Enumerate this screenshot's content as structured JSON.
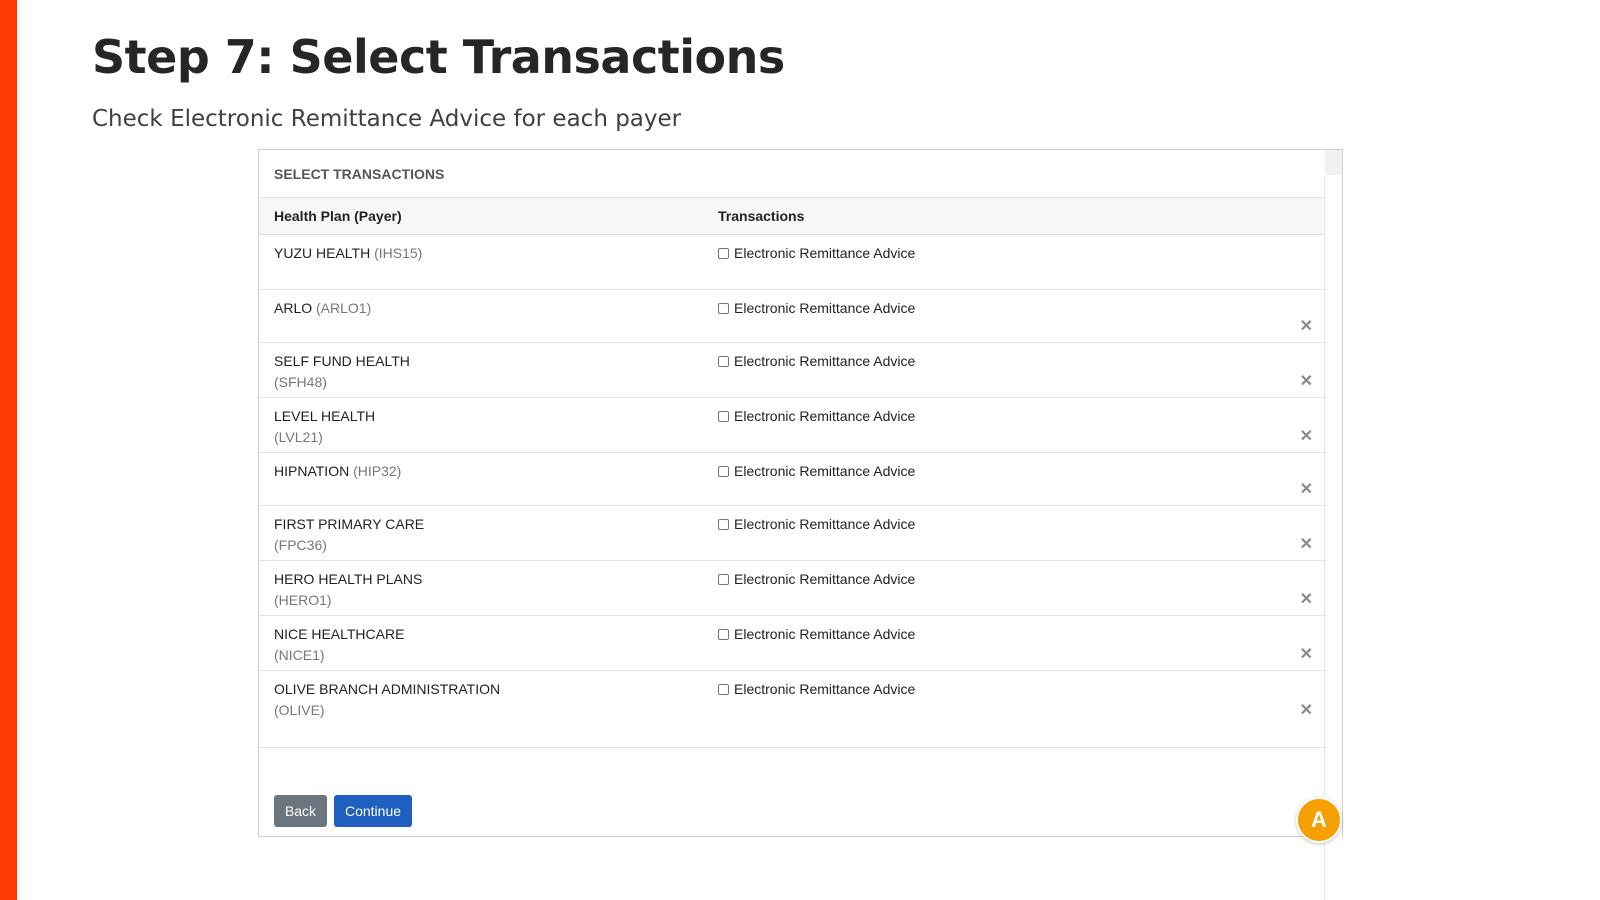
{
  "slide": {
    "title": "Step 7: Select Transactions",
    "subtitle": "Check Electronic Remittance Advice for each payer",
    "accent_color": "#ff3b00"
  },
  "panel": {
    "header": "SELECT TRANSACTIONS",
    "columns": {
      "payer": "Health Plan (Payer)",
      "transactions": "Transactions"
    },
    "transaction_label": "Electronic Remittance Advice",
    "remove_icon": "close-icon",
    "payers": [
      {
        "name": "YUZU HEALTH",
        "code": "(IHS15)",
        "removable": false
      },
      {
        "name": "ARLO",
        "code": "(ARLO1)",
        "removable": true
      },
      {
        "name": "SELF FUND HEALTH",
        "code": "(SFH48)",
        "removable": true
      },
      {
        "name": "LEVEL HEALTH",
        "code": "(LVL21)",
        "removable": true
      },
      {
        "name": "HIPNATION",
        "code": "(HIP32)",
        "removable": true
      },
      {
        "name": "FIRST PRIMARY CARE",
        "code": "(FPC36)",
        "removable": true
      },
      {
        "name": "HERO HEALTH PLANS",
        "code": "(HERO1)",
        "removable": true
      },
      {
        "name": "NICE HEALTHCARE",
        "code": "(NICE1)",
        "removable": true
      },
      {
        "name": "OLIVE BRANCH ADMINISTRATION",
        "code": "(OLIVE)",
        "removable": true
      }
    ],
    "buttons": {
      "back": "Back",
      "continue": "Continue"
    },
    "colors": {
      "back": "#6c757d",
      "continue": "#1f5fbf"
    }
  },
  "avatar": {
    "letter": "A",
    "color": "#f5a000"
  }
}
